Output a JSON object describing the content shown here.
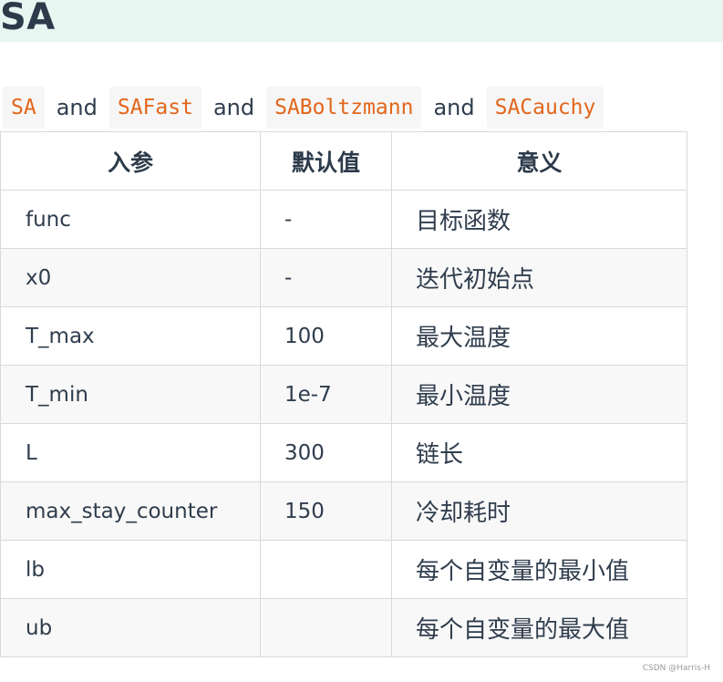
{
  "heading": {
    "title": "SA"
  },
  "subtitle": {
    "parts": [
      {
        "kind": "code",
        "text": "SA"
      },
      {
        "kind": "text",
        "text": "and"
      },
      {
        "kind": "code",
        "text": "SAFast"
      },
      {
        "kind": "text",
        "text": "and"
      },
      {
        "kind": "code",
        "text": "SABoltzmann"
      },
      {
        "kind": "text",
        "text": "and"
      },
      {
        "kind": "code",
        "text": "SACauchy"
      }
    ]
  },
  "table": {
    "headers": [
      "入参",
      "默认值",
      "意义"
    ],
    "rows": [
      [
        "func",
        "-",
        "目标函数"
      ],
      [
        "x0",
        "-",
        "迭代初始点"
      ],
      [
        "T_max",
        "100",
        "最大温度"
      ],
      [
        "T_min",
        "1e-7",
        "最小温度"
      ],
      [
        "L",
        "300",
        "链长"
      ],
      [
        "max_stay_counter",
        "150",
        "冷却耗时"
      ],
      [
        "lb",
        "",
        "每个自变量的最小值"
      ],
      [
        "ub",
        "",
        "每个自变量的最大值"
      ]
    ]
  },
  "watermark": "CSDN @Harris-H",
  "colors": {
    "heading_bg": "#e7f6f1",
    "code_text": "#e2661b",
    "code_bg": "#f6f6f6",
    "text": "#2f3d4d",
    "border": "#d9d9d9",
    "stripe": "#f8f8f8"
  }
}
